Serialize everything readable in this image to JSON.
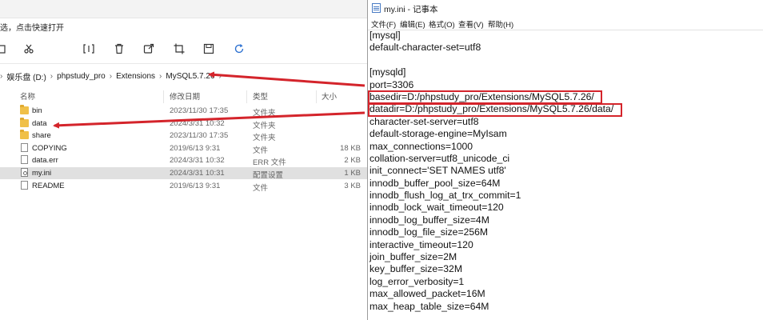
{
  "explorer": {
    "hint_text": "选，点击快速打开",
    "toolbar_icons": [
      "copy-icon",
      "cut-icon",
      "rename-icon",
      "delete-icon",
      "share-icon",
      "crop-icon",
      "save-icon",
      "refresh-icon"
    ],
    "breadcrumb": [
      "娱乐盘 (D:)",
      "phpstudy_pro",
      "Extensions",
      "MySQL5.7.26"
    ],
    "breadcrumb_sep": "›",
    "columns": {
      "name": "名称",
      "date": "修改日期",
      "type": "类型",
      "size": "大小"
    },
    "files": [
      {
        "name": "bin",
        "date": "2023/11/30 17:35",
        "type": "文件夹",
        "size": "",
        "icon": "folder-icon"
      },
      {
        "name": "data",
        "date": "2024/3/31 10:32",
        "type": "文件夹",
        "size": "",
        "icon": "folder-icon"
      },
      {
        "name": "share",
        "date": "2023/11/30 17:35",
        "type": "文件夹",
        "size": "",
        "icon": "folder-icon"
      },
      {
        "name": "COPYING",
        "date": "2019/6/13 9:31",
        "type": "文件",
        "size": "18 KB",
        "icon": "file-icon"
      },
      {
        "name": "data.err",
        "date": "2024/3/31 10:32",
        "type": "ERR 文件",
        "size": "2 KB",
        "icon": "file-icon"
      },
      {
        "name": "my.ini",
        "date": "2024/3/31 10:31",
        "type": "配置设置",
        "size": "1 KB",
        "icon": "config-file-icon",
        "selected": true
      },
      {
        "name": "README",
        "date": "2019/6/13 9:31",
        "type": "文件",
        "size": "3 KB",
        "icon": "file-icon"
      }
    ]
  },
  "notepad": {
    "title": "my.ini - 记事本",
    "menu": [
      "文件(F)",
      "编辑(E)",
      "格式(O)",
      "查看(V)",
      "帮助(H)"
    ],
    "lines": [
      "[mysql]",
      "default-character-set=utf8",
      "",
      "[mysqld]",
      "port=3306",
      "basedir=D:/phpstudy_pro/Extensions/MySQL5.7.26/",
      "datadir=D:/phpstudy_pro/Extensions/MySQL5.7.26/data/",
      "character-set-server=utf8",
      "default-storage-engine=MyIsam",
      "max_connections=1000",
      "collation-server=utf8_unicode_ci",
      "init_connect='SET NAMES utf8'",
      "innodb_buffer_pool_size=64M",
      "innodb_flush_log_at_trx_commit=1",
      "innodb_lock_wait_timeout=120",
      "innodb_log_buffer_size=4M",
      "innodb_log_file_size=256M",
      "interactive_timeout=120",
      "join_buffer_size=2M",
      "key_buffer_size=32M",
      "log_error_verbosity=1",
      "max_allowed_packet=16M",
      "max_heap_table_size=64M"
    ]
  },
  "annotation_color": "#d4242b"
}
